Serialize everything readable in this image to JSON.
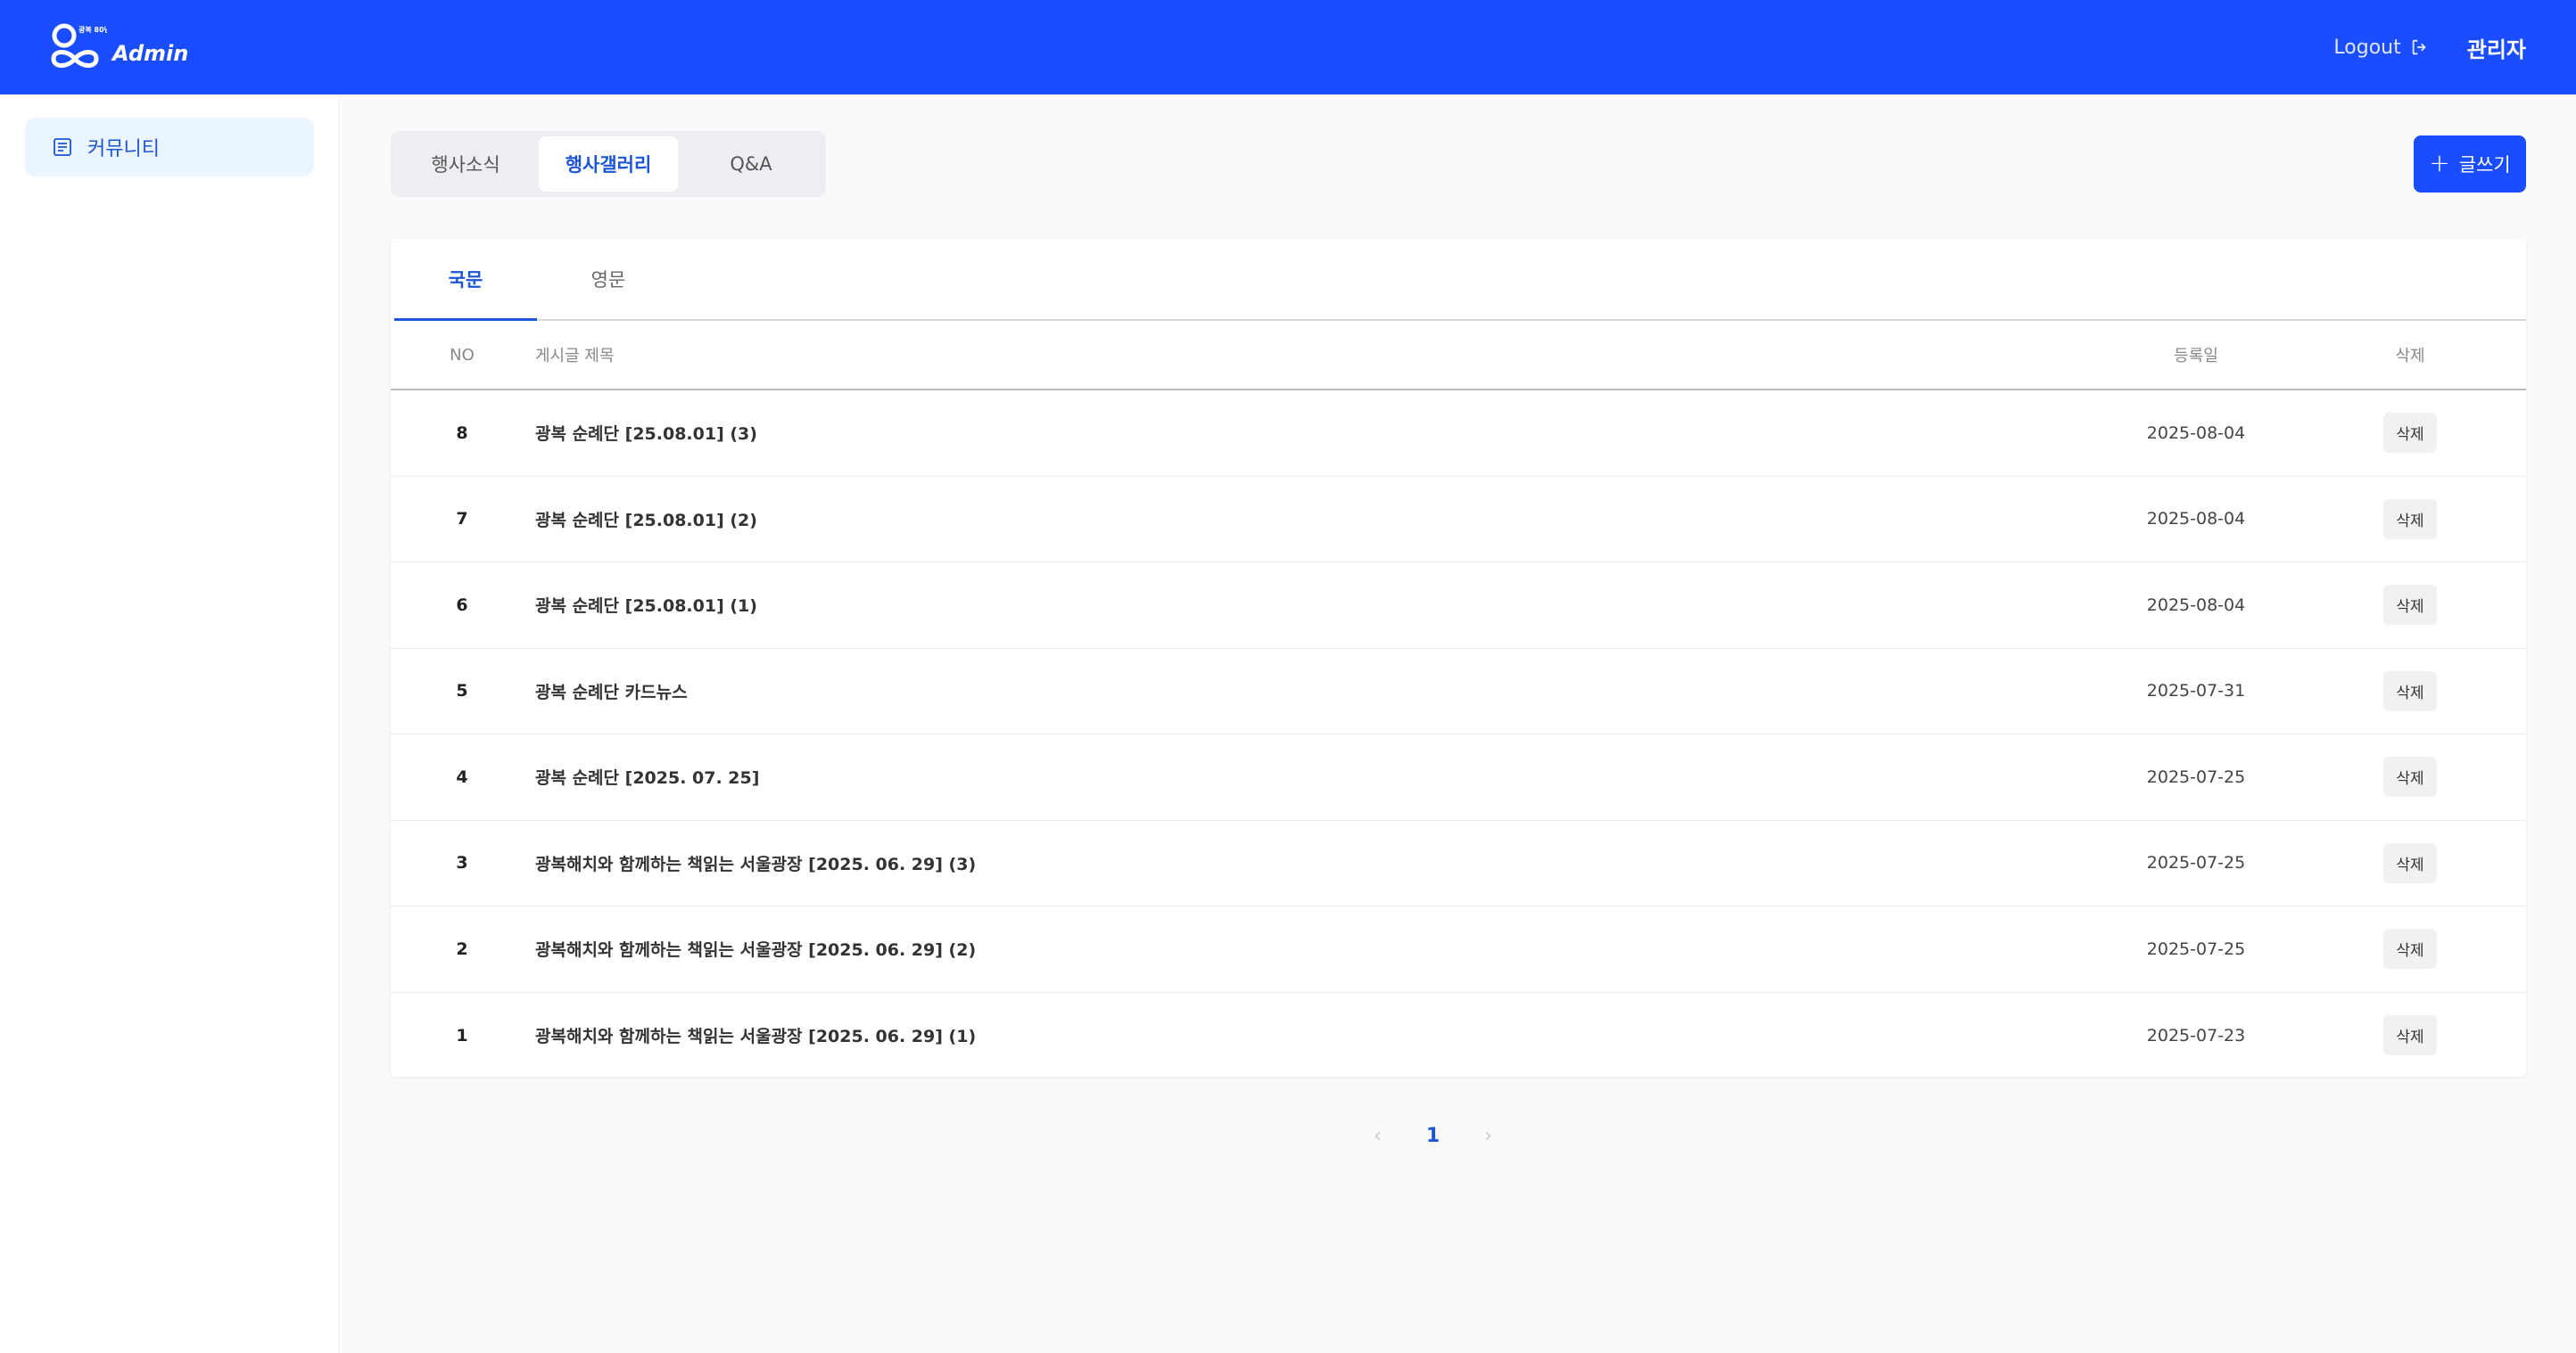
{
  "header": {
    "logo_badge": "광복 80년",
    "logo_text": "Admin",
    "logout_label": "Logout",
    "user_name": "관리자",
    "brand_color": "#1a4dff"
  },
  "sidebar": {
    "items": [
      {
        "label": "커뮤니티",
        "icon": "document-list-icon",
        "active": true
      }
    ]
  },
  "category_tabs": [
    {
      "label": "행사소식",
      "active": false
    },
    {
      "label": "행사갤러리",
      "active": true
    },
    {
      "label": "Q&A",
      "active": false
    }
  ],
  "write_button": {
    "label": "글쓰기",
    "icon": "plus-icon"
  },
  "language_tabs": [
    {
      "label": "국문",
      "active": true
    },
    {
      "label": "영문",
      "active": false
    }
  ],
  "table": {
    "columns": {
      "no": "NO",
      "title": "게시글 제목",
      "date": "등록일",
      "delete": "삭제"
    },
    "rows": [
      {
        "no": "8",
        "title": "광복 순례단 [25.08.01] (3)",
        "date": "2025-08-04",
        "action": "삭제"
      },
      {
        "no": "7",
        "title": "광복 순례단 [25.08.01] (2)",
        "date": "2025-08-04",
        "action": "삭제"
      },
      {
        "no": "6",
        "title": "광복 순례단 [25.08.01] (1)",
        "date": "2025-08-04",
        "action": "삭제"
      },
      {
        "no": "5",
        "title": "광복 순례단 카드뉴스",
        "date": "2025-07-31",
        "action": "삭제"
      },
      {
        "no": "4",
        "title": "광복 순례단 [2025. 07. 25]",
        "date": "2025-07-25",
        "action": "삭제"
      },
      {
        "no": "3",
        "title": "광복해치와 함께하는 책읽는 서울광장 [2025. 06. 29] (3)",
        "date": "2025-07-25",
        "action": "삭제"
      },
      {
        "no": "2",
        "title": "광복해치와 함께하는 책읽는 서울광장 [2025. 06. 29] (2)",
        "date": "2025-07-25",
        "action": "삭제"
      },
      {
        "no": "1",
        "title": "광복해치와 함께하는 책읽는 서울광장 [2025. 06. 29] (1)",
        "date": "2025-07-23",
        "action": "삭제"
      }
    ]
  },
  "pagination": {
    "prev": "‹",
    "current": "1",
    "next": "›"
  }
}
